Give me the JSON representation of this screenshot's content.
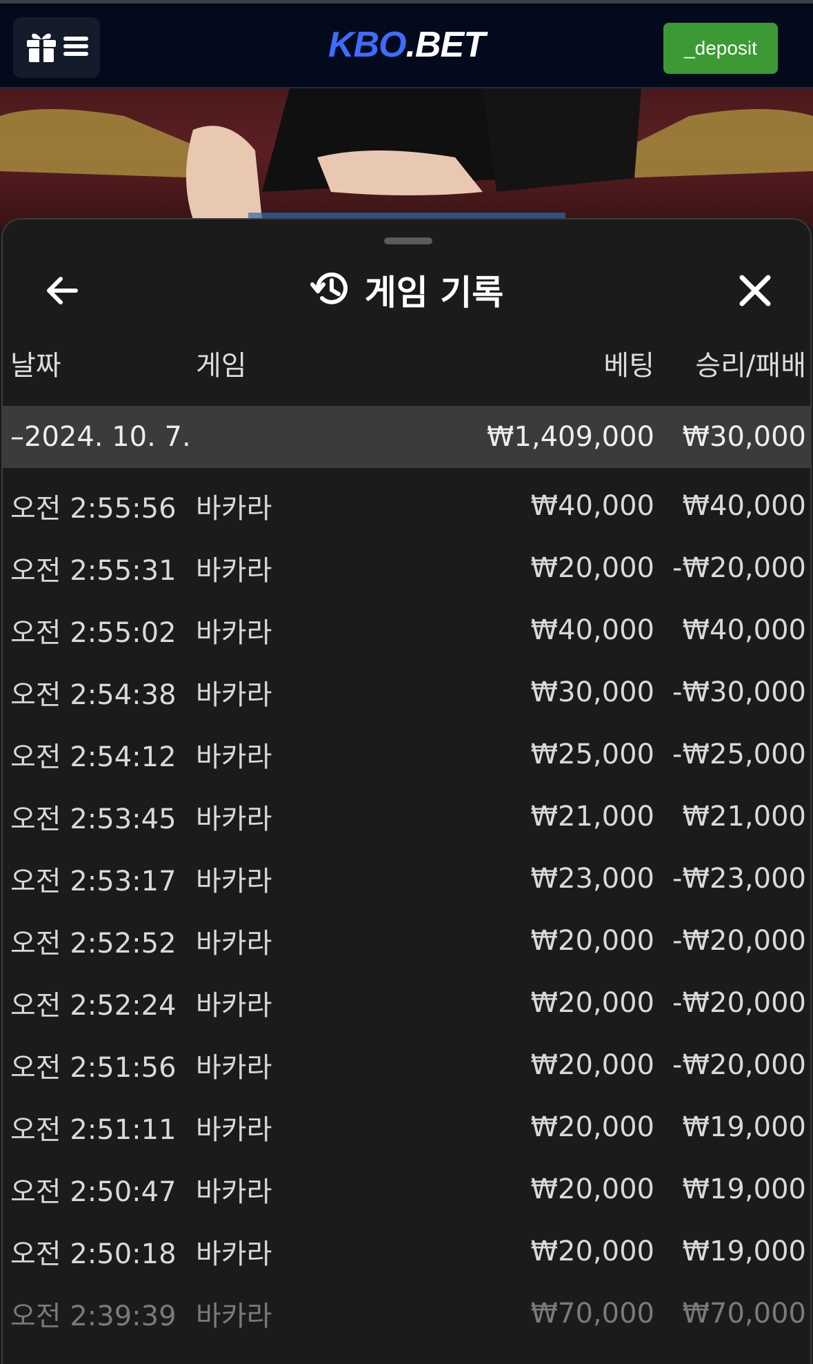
{
  "header": {
    "logo_kbo": "KBO",
    "logo_bet": ".BET",
    "deposit_label": "_deposit"
  },
  "sheet": {
    "title": "게임 기록",
    "columns": {
      "date": "날짜",
      "game": "게임",
      "bet": "베팅",
      "win_loss": "승리/패배"
    },
    "date_group": {
      "date": "–2024. 10. 7.",
      "bet_total": "₩1,409,000",
      "win_total": "₩30,000"
    },
    "rows": [
      {
        "time": "오전 2:55:56",
        "game": "바카라",
        "bet": "₩40,000",
        "win": "₩40,000"
      },
      {
        "time": "오전 2:55:31",
        "game": "바카라",
        "bet": "₩20,000",
        "win": "-₩20,000"
      },
      {
        "time": "오전 2:55:02",
        "game": "바카라",
        "bet": "₩40,000",
        "win": "₩40,000"
      },
      {
        "time": "오전 2:54:38",
        "game": "바카라",
        "bet": "₩30,000",
        "win": "-₩30,000"
      },
      {
        "time": "오전 2:54:12",
        "game": "바카라",
        "bet": "₩25,000",
        "win": "-₩25,000"
      },
      {
        "time": "오전 2:53:45",
        "game": "바카라",
        "bet": "₩21,000",
        "win": "₩21,000"
      },
      {
        "time": "오전 2:53:17",
        "game": "바카라",
        "bet": "₩23,000",
        "win": "-₩23,000"
      },
      {
        "time": "오전 2:52:52",
        "game": "바카라",
        "bet": "₩20,000",
        "win": "-₩20,000"
      },
      {
        "time": "오전 2:52:24",
        "game": "바카라",
        "bet": "₩20,000",
        "win": "-₩20,000"
      },
      {
        "time": "오전 2:51:56",
        "game": "바카라",
        "bet": "₩20,000",
        "win": "-₩20,000"
      },
      {
        "time": "오전 2:51:11",
        "game": "바카라",
        "bet": "₩20,000",
        "win": "₩19,000"
      },
      {
        "time": "오전 2:50:47",
        "game": "바카라",
        "bet": "₩20,000",
        "win": "₩19,000"
      },
      {
        "time": "오전 2:50:18",
        "game": "바카라",
        "bet": "₩20,000",
        "win": "₩19,000"
      },
      {
        "time": "오전 2:39:39",
        "game": "바카라",
        "bet": "₩70,000",
        "win": "₩70,000"
      }
    ]
  },
  "icons": {
    "menu": "gift-menu-icon",
    "back": "arrow-left-icon",
    "history": "history-icon",
    "close": "close-icon"
  },
  "colors": {
    "header_bg": "#030a1c",
    "brand_blue": "#3d6dff",
    "deposit_green": "#3c9a34",
    "sheet_bg": "#1b1b1b",
    "date_row_bg": "#3b3b3b"
  }
}
